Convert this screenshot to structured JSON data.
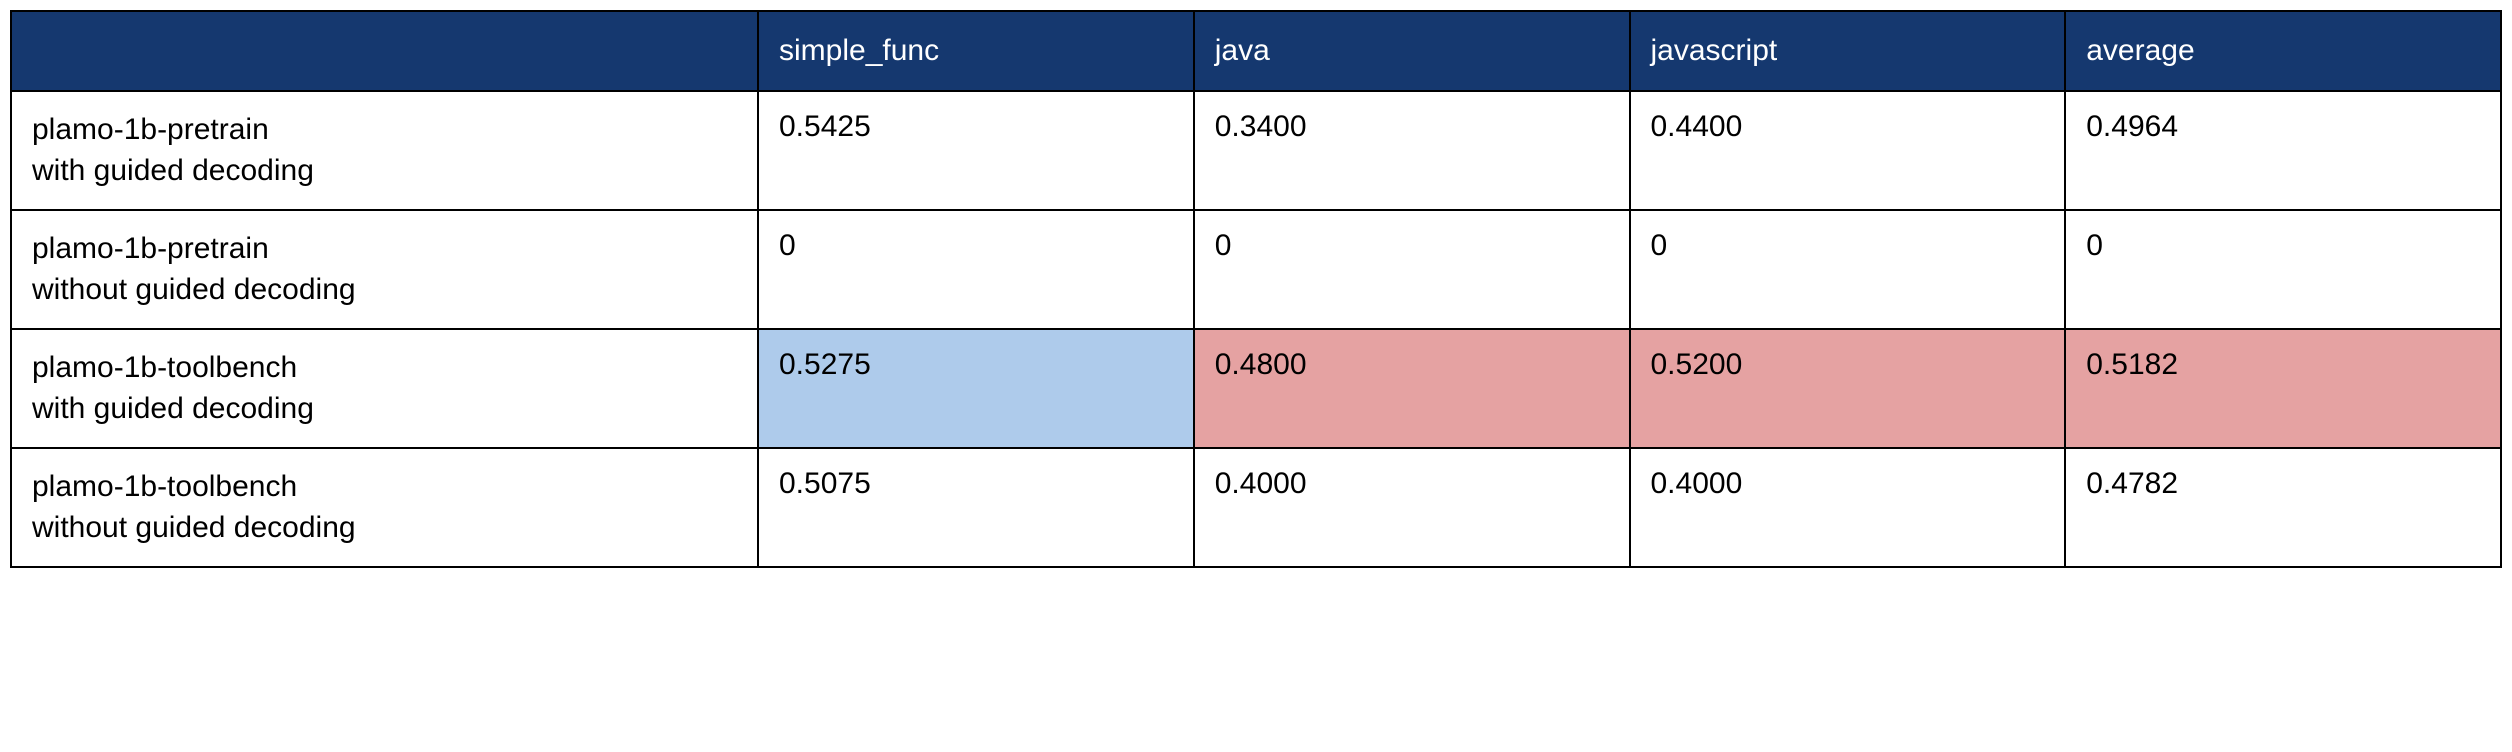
{
  "chart_data": {
    "type": "table",
    "columns": [
      "",
      "simple_func",
      "java",
      "javascript",
      "average"
    ],
    "rows": [
      {
        "label": "plamo-1b-pretrain\nwith guided decoding",
        "cells": [
          {
            "value": "0.5425",
            "highlight": null
          },
          {
            "value": "0.3400",
            "highlight": null
          },
          {
            "value": "0.4400",
            "highlight": null
          },
          {
            "value": "0.4964",
            "highlight": null
          }
        ]
      },
      {
        "label": "plamo-1b-pretrain\nwithout guided decoding",
        "cells": [
          {
            "value": "0",
            "highlight": null
          },
          {
            "value": "0",
            "highlight": null
          },
          {
            "value": "0",
            "highlight": null
          },
          {
            "value": "0",
            "highlight": null
          }
        ]
      },
      {
        "label": "plamo-1b-toolbench\nwith guided decoding",
        "cells": [
          {
            "value": "0.5275",
            "highlight": "blue"
          },
          {
            "value": "0.4800",
            "highlight": "red"
          },
          {
            "value": "0.5200",
            "highlight": "red"
          },
          {
            "value": "0.5182",
            "highlight": "red"
          }
        ]
      },
      {
        "label": "plamo-1b-toolbench\nwithout guided decoding",
        "cells": [
          {
            "value": "0.5075",
            "highlight": null
          },
          {
            "value": "0.4000",
            "highlight": null
          },
          {
            "value": "0.4000",
            "highlight": null
          },
          {
            "value": "0.4782",
            "highlight": null
          }
        ]
      }
    ],
    "colors": {
      "header_bg": "#15386f",
      "blue": "#aecbeb",
      "red": "#e5a2a2"
    }
  }
}
